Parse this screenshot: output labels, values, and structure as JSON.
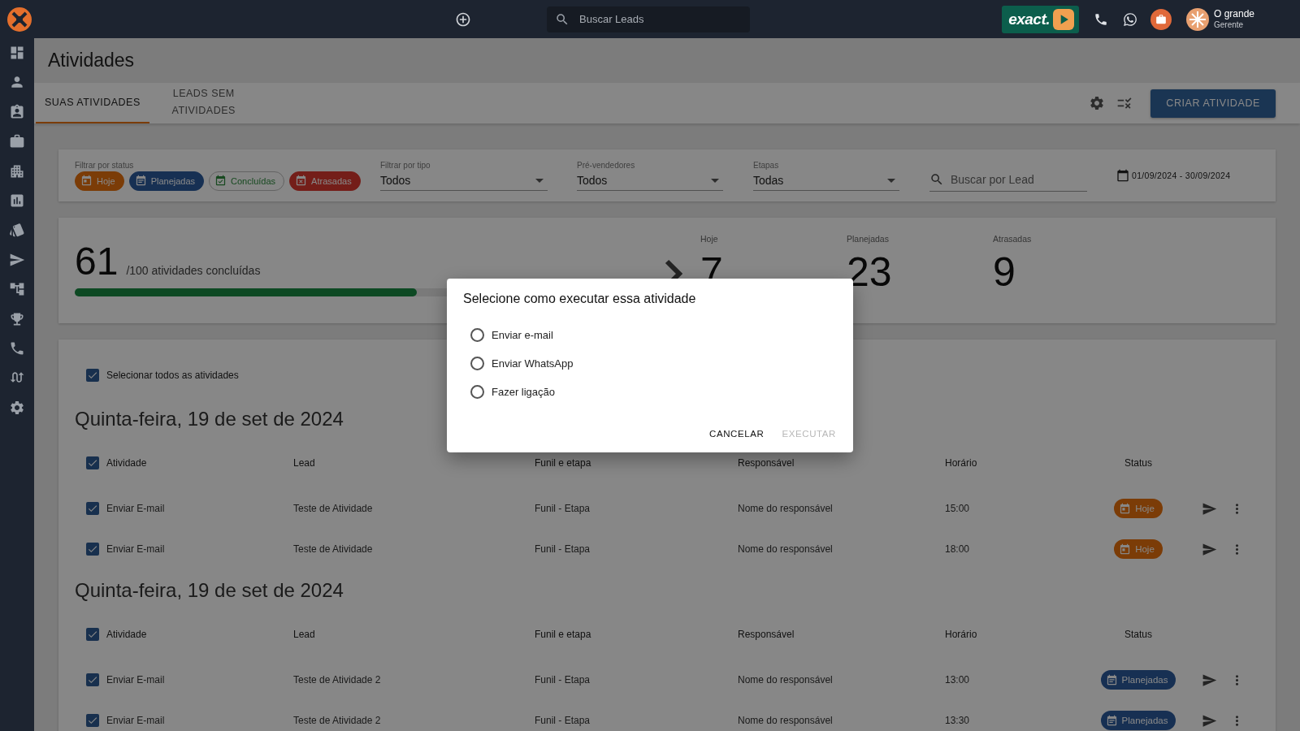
{
  "topbar": {
    "search": {
      "placeholder": "Buscar Leads"
    },
    "brand": "exact.",
    "user": {
      "name": "O grande",
      "role": "Gerente"
    }
  },
  "page": {
    "title": "Atividades"
  },
  "tabs": [
    {
      "label": "SUAS ATIVIDADES",
      "selected": true
    },
    {
      "label": "LEADS SEM ATIVIDADES",
      "selected": false
    }
  ],
  "create_button": "CRIAR ATIVIDADE",
  "filters": {
    "status_label": "Filtrar por status",
    "status_chips": [
      {
        "label": "Hoje",
        "kind": "hoje",
        "selected": true
      },
      {
        "label": "Planejadas",
        "kind": "planejadas",
        "selected": true
      },
      {
        "label": "Concluídas",
        "kind": "concluidas",
        "selected": false
      },
      {
        "label": "Atrasadas",
        "kind": "atrasadas",
        "selected": true
      }
    ],
    "selects": [
      {
        "label": "Filtrar por tipo",
        "value": "Todos"
      },
      {
        "label": "Pré-vendedores",
        "value": "Todos"
      },
      {
        "label": "Etapas",
        "value": "Todas"
      }
    ],
    "search": {
      "placeholder": "Buscar por Lead"
    },
    "date_range": "01/09/2024 - 30/09/2024"
  },
  "summary": {
    "done": "61",
    "total_label": "/100 atividades concluídas",
    "level": 0.61,
    "counters": [
      {
        "label": "Hoje",
        "value": "7"
      },
      {
        "label": "Planejadas",
        "value": "23"
      },
      {
        "label": "Atrasadas",
        "value": "9"
      }
    ]
  },
  "list": {
    "select_all": {
      "label": "Selecionar todos as atividades",
      "checked": true
    },
    "groups": [
      {
        "date": "Quinta-feira, 19 de set de 2024",
        "all_checked": true,
        "columns": [
          "Atividade",
          "Lead",
          "Funil e etapa",
          "Responsável",
          "Horário",
          "Status"
        ],
        "rows": [
          {
            "checked": true,
            "activity": "Enviar E-mail",
            "lead": "Teste de Atividade",
            "funnel": "Funil - Etapa",
            "responsible": "Nome do responsável",
            "time": "15:00",
            "status": {
              "label": "Hoje",
              "kind": "hoje"
            }
          },
          {
            "checked": true,
            "activity": "Enviar E-mail",
            "lead": "Teste de Atividade",
            "funnel": "Funil - Etapa",
            "responsible": "Nome do responsável",
            "time": "18:00",
            "status": {
              "label": "Hoje",
              "kind": "hoje"
            }
          }
        ]
      },
      {
        "date": "Quinta-feira, 19 de set de 2024",
        "all_checked": true,
        "columns": [
          "Atividade",
          "Lead",
          "Funil e etapa",
          "Responsável",
          "Horário",
          "Status"
        ],
        "rows": [
          {
            "checked": true,
            "activity": "Enviar E-mail",
            "lead": "Teste de Atividade 2",
            "funnel": "Funil - Etapa",
            "responsible": "Nome do responsável",
            "time": "13:00",
            "status": {
              "label": "Planejadas",
              "kind": "planejadas"
            }
          },
          {
            "checked": true,
            "activity": "Enviar E-mail",
            "lead": "Teste de Atividade 2",
            "funnel": "Funil - Etapa",
            "responsible": "Nome do responsável",
            "time": "13:30",
            "status": {
              "label": "Planejadas",
              "kind": "planejadas"
            }
          }
        ]
      }
    ]
  },
  "dialog": {
    "title": "Selecione como executar essa atividade",
    "options": [
      {
        "label": "Enviar e-mail",
        "selected": false
      },
      {
        "label": "Enviar WhatsApp",
        "selected": false
      },
      {
        "label": "Fazer ligação",
        "selected": false
      }
    ],
    "buttons": [
      {
        "label": "CANCELAR",
        "disabled": false
      },
      {
        "label": "EXECUTAR",
        "disabled": true
      }
    ]
  }
}
